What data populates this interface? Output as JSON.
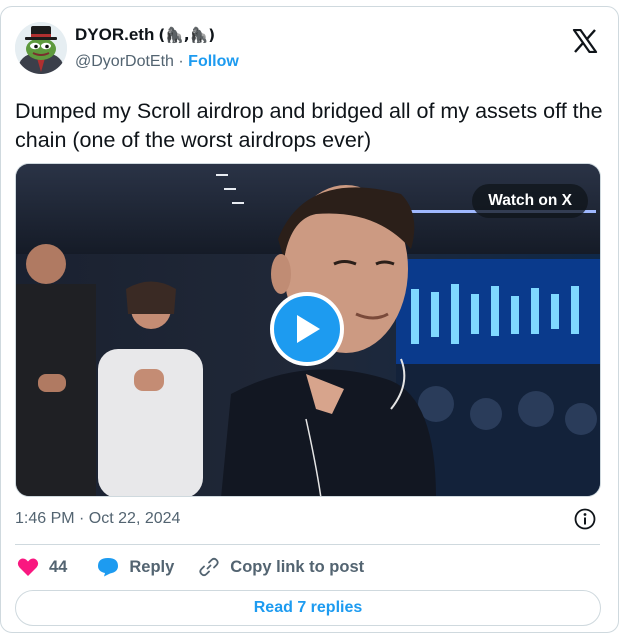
{
  "author": {
    "display_name": "DYOR.eth",
    "name_suffix": "(🦍,🦍)",
    "handle": "@DyorDotEth",
    "separator": "·",
    "follow_label": "Follow"
  },
  "tweet": {
    "text": "Dumped my Scroll airdrop and bridged all of my assets off the chain (one of the worst airdrops ever)"
  },
  "media": {
    "watch_label": "Watch on X"
  },
  "meta": {
    "timestamp": "1:46 PM · Oct 22, 2024"
  },
  "actions": {
    "like_count": "44",
    "reply_label": "Reply",
    "copy_link_label": "Copy link to post"
  },
  "read_replies_label": "Read 7 replies",
  "colors": {
    "accent": "#1d9bf0",
    "like": "#f91880",
    "text": "#0f1419",
    "muted": "#536471",
    "border": "#cfd9de"
  },
  "icons": [
    "avatar-pepe",
    "x-logo-icon",
    "play-icon",
    "info-icon",
    "heart-icon",
    "reply-bubble-icon",
    "link-icon"
  ]
}
